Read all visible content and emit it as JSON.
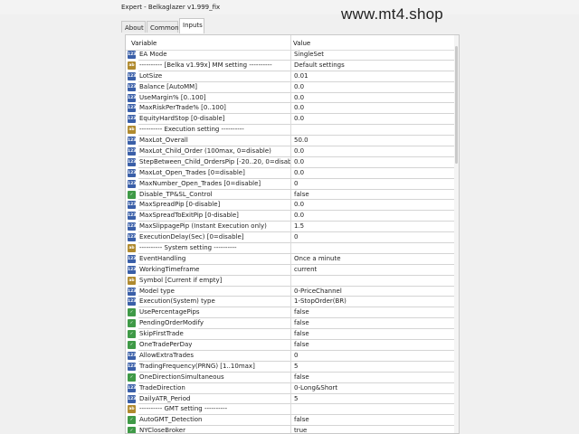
{
  "window": {
    "title": "Expert - Belkaglazer v1.999_fix"
  },
  "watermark": "www.mt4.shop",
  "tabs": [
    {
      "label": "About"
    },
    {
      "label": "Common"
    },
    {
      "label": "Inputs"
    }
  ],
  "table": {
    "col_variable": "Variable",
    "col_value": "Value",
    "rows": [
      {
        "icon": "num",
        "name": "EA Mode",
        "value": "SingleSet"
      },
      {
        "icon": "str",
        "name": "---------- [Belka v1.99x] MM setting ----------",
        "value": "Default settings"
      },
      {
        "icon": "num",
        "name": "LotSize",
        "value": "0.01"
      },
      {
        "icon": "num",
        "name": "Balance [AutoMM]",
        "value": "0.0"
      },
      {
        "icon": "num",
        "name": "UseMargin% [0..100]",
        "value": "0.0"
      },
      {
        "icon": "num",
        "name": "MaxRiskPerTrade% [0..100]",
        "value": "0.0"
      },
      {
        "icon": "num",
        "name": "EquityHardStop [0-disable]",
        "value": "0.0"
      },
      {
        "icon": "str",
        "name": "---------- Execution setting ----------",
        "value": ""
      },
      {
        "icon": "num",
        "name": "MaxLot_Overall",
        "value": "50.0"
      },
      {
        "icon": "num",
        "name": "MaxLot_Child_Order (100max, 0=disable)",
        "value": "0.0"
      },
      {
        "icon": "num",
        "name": "StepBetween_Child_OrdersPip [-20..20, 0=disable]",
        "value": "0.0"
      },
      {
        "icon": "num",
        "name": "MaxLot_Open_Trades [0=disable]",
        "value": "0.0"
      },
      {
        "icon": "num",
        "name": "MaxNumber_Open_Trades [0=disable]",
        "value": "0"
      },
      {
        "icon": "bool",
        "name": "Disable_TP&SL_Control",
        "value": "false"
      },
      {
        "icon": "num",
        "name": "MaxSpreadPip [0-disable]",
        "value": "0.0"
      },
      {
        "icon": "num",
        "name": "MaxSpreadToExitPip [0-disable]",
        "value": "0.0"
      },
      {
        "icon": "num",
        "name": "MaxSlippagePip (Instant Execution only)",
        "value": "1.5"
      },
      {
        "icon": "num",
        "name": "ExecutionDelay(Sec) [0=disable]",
        "value": "0"
      },
      {
        "icon": "str",
        "name": "---------- System setting ----------",
        "value": ""
      },
      {
        "icon": "en",
        "name": "EventHandling",
        "value": "Once a minute"
      },
      {
        "icon": "en",
        "name": "WorkingTimeframe",
        "value": "current"
      },
      {
        "icon": "str",
        "name": "Symbol [Current if empty]",
        "value": ""
      },
      {
        "icon": "en",
        "name": "Model type",
        "value": "0-PriceChannel"
      },
      {
        "icon": "en",
        "name": "Execution(System) type",
        "value": "1-StopOrder(BR)"
      },
      {
        "icon": "bool",
        "name": "UsePercentagePips",
        "value": "false"
      },
      {
        "icon": "bool",
        "name": "PendingOrderModify",
        "value": "false"
      },
      {
        "icon": "bool",
        "name": "SkipFirstTrade",
        "value": "false"
      },
      {
        "icon": "bool",
        "name": "OneTradePerDay",
        "value": "false"
      },
      {
        "icon": "num",
        "name": "AllowExtraTrades",
        "value": "0"
      },
      {
        "icon": "num",
        "name": "TradingFrequency(PRNG) [1..10max]",
        "value": "5"
      },
      {
        "icon": "bool",
        "name": "OneDirectionSimultaneous",
        "value": "false"
      },
      {
        "icon": "en",
        "name": "TradeDirection",
        "value": "0-Long&Short"
      },
      {
        "icon": "num",
        "name": "DailyATR_Period",
        "value": "5"
      },
      {
        "icon": "str",
        "name": "---------- GMT setting ----------",
        "value": ""
      },
      {
        "icon": "bool",
        "name": "AutoGMT_Detection",
        "value": "false"
      },
      {
        "icon": "bool",
        "name": "NYCloseBroker",
        "value": "true"
      }
    ]
  },
  "icon_labels": {
    "num": "123",
    "str": "ab",
    "bool": "✓",
    "en": "123"
  }
}
